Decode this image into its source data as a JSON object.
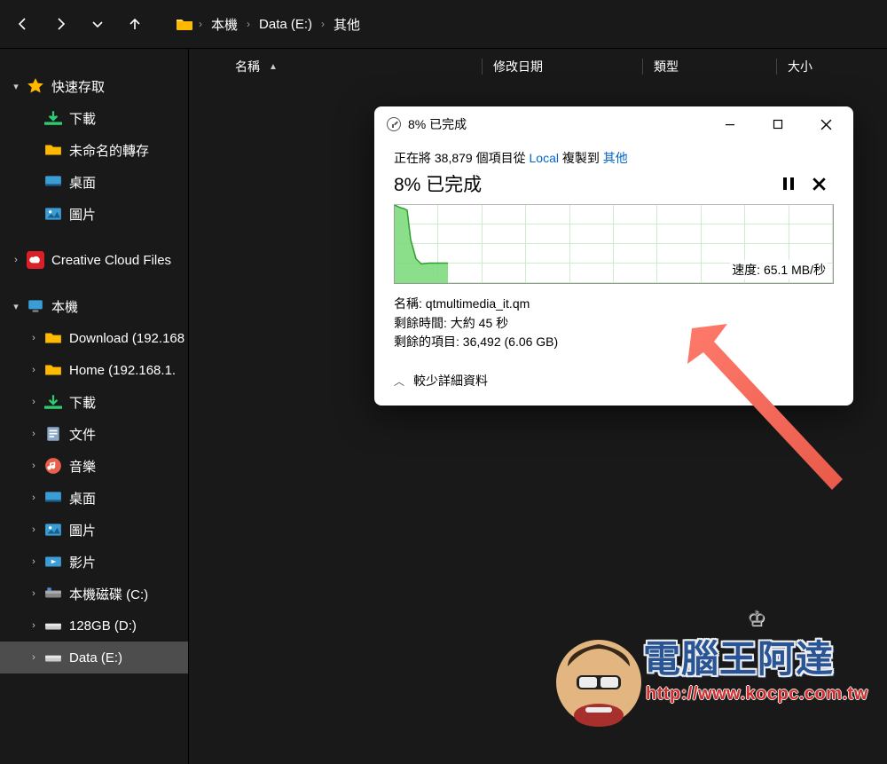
{
  "nav": {
    "breadcrumb": [
      "本機",
      "Data (E:)",
      "其他"
    ]
  },
  "columns": {
    "name": "名稱",
    "date": "修改日期",
    "type": "類型",
    "size": "大小"
  },
  "sidebar": {
    "quick_access": "快速存取",
    "quick_items": [
      {
        "label": "下載",
        "icon": "download"
      },
      {
        "label": "未命名的轉存",
        "icon": "folder"
      },
      {
        "label": "桌面",
        "icon": "desktop"
      },
      {
        "label": "圖片",
        "icon": "pictures"
      }
    ],
    "creative_cloud": "Creative Cloud Files",
    "this_pc": "本機",
    "pc_items": [
      {
        "label": "Download (192.168",
        "icon": "netfolder"
      },
      {
        "label": "Home (192.168.1.",
        "icon": "netfolder"
      },
      {
        "label": "下載",
        "icon": "download"
      },
      {
        "label": "文件",
        "icon": "documents"
      },
      {
        "label": "音樂",
        "icon": "music"
      },
      {
        "label": "桌面",
        "icon": "desktop"
      },
      {
        "label": "圖片",
        "icon": "pictures"
      },
      {
        "label": "影片",
        "icon": "videos"
      },
      {
        "label": "本機磁碟 (C:)",
        "icon": "drive"
      },
      {
        "label": "128GB (D:)",
        "icon": "ssd"
      },
      {
        "label": "Data (E:)",
        "icon": "ssd",
        "selected": true
      }
    ]
  },
  "dialog": {
    "title": "8% 已完成",
    "status_pre": "正在將 38,879 個項目從 ",
    "status_src": "Local",
    "status_mid": " 複製到 ",
    "status_dst": "其他",
    "percent": "8% 已完成",
    "speed_label": "速度: 65.1 MB/秒",
    "name_label": "名稱:",
    "name_value": "qtmultimedia_it.qm",
    "time_label": "剩餘時間:",
    "time_value": "大約 45 秒",
    "items_label": "剩餘的項目:",
    "items_value": "36,492 (6.06 GB)",
    "less_details": "較少詳細資料"
  },
  "watermark": {
    "title": "電腦王阿達",
    "url": "http://www.kocpc.com.tw"
  },
  "chart_data": {
    "type": "area",
    "title": "Transfer speed",
    "ylabel": "MB/秒",
    "ylim": [
      0,
      260
    ],
    "x": [
      0,
      1,
      2,
      3,
      4,
      5,
      6,
      7,
      8,
      9,
      10,
      11,
      12
    ],
    "values": [
      260,
      255,
      250,
      240,
      150,
      80,
      60,
      62,
      65,
      65,
      65,
      65,
      65
    ],
    "current_speed_mbps": 65.1
  }
}
